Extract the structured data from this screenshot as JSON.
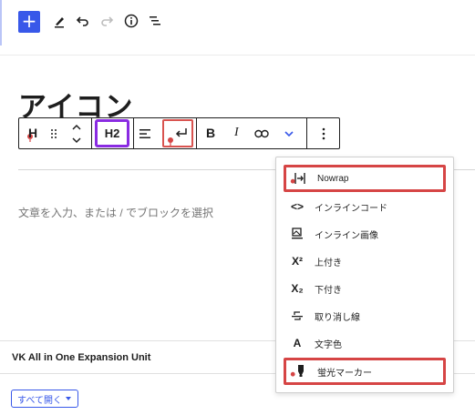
{
  "editor_toolbar": {
    "add_label": "+"
  },
  "content": {
    "heading_text": "アイコン",
    "placeholder": "文章を入力、または / でブロックを選択"
  },
  "block_toolbar": {
    "heading_icon_label": "H",
    "level_label": "H2",
    "bold_label": "B",
    "italic_label": "I"
  },
  "dropdown": {
    "items": [
      {
        "label": "Nowrap",
        "icon": "nowrap-icon",
        "highlighted": true
      },
      {
        "label": "インラインコード",
        "icon": "code-icon",
        "glyph": "<>"
      },
      {
        "label": "インライン画像",
        "icon": "inline-image-icon"
      },
      {
        "label": "上付き",
        "icon": "superscript-icon",
        "glyph": "X²"
      },
      {
        "label": "下付き",
        "icon": "subscript-icon",
        "glyph": "X₂"
      },
      {
        "label": "取り消し線",
        "icon": "strikethrough-icon"
      },
      {
        "label": "文字色",
        "icon": "text-color-icon",
        "glyph": "A"
      },
      {
        "label": "蛍光マーカー",
        "icon": "highlighter-icon",
        "highlighted": true
      }
    ]
  },
  "sidebar_panel": {
    "title": "VK All in One Expansion Unit",
    "expand_label": "すべて開く"
  },
  "colors": {
    "accent": "#3858e9",
    "highlight_red": "#d64545",
    "highlight_purple": "#8a2be2"
  }
}
